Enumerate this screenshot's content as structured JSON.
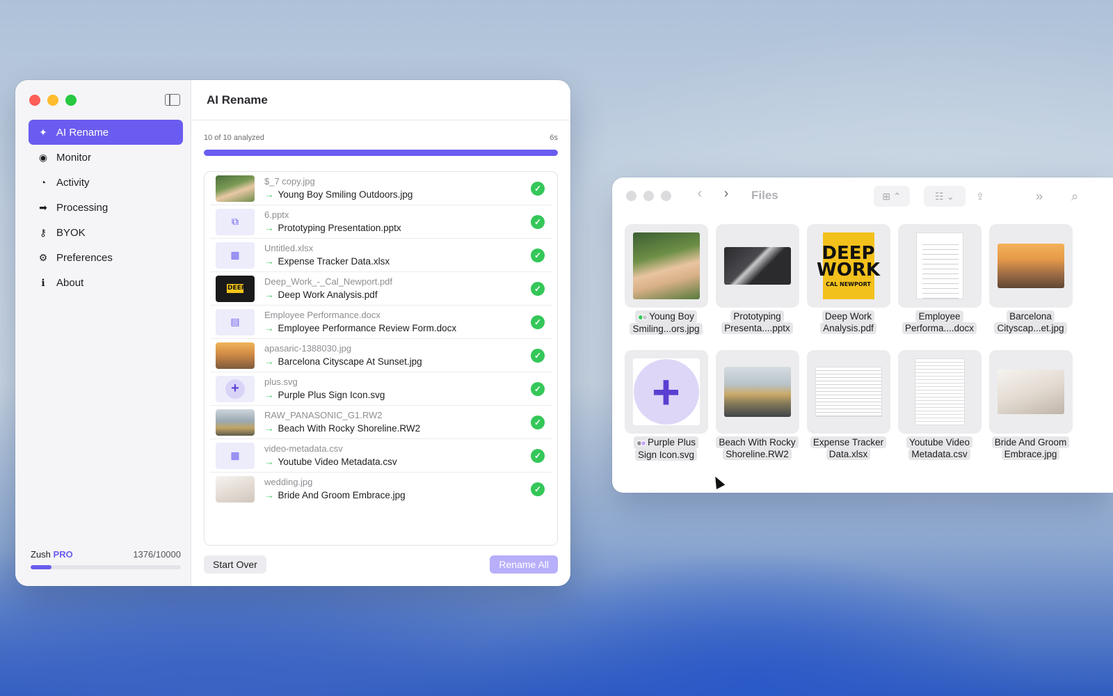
{
  "sidebar": {
    "items": [
      {
        "label": "AI Rename",
        "icon": "ai-rename-icon",
        "glyph": "✦",
        "active": true
      },
      {
        "label": "Monitor",
        "icon": "eye-icon",
        "glyph": "◉",
        "active": false
      },
      {
        "label": "Activity",
        "icon": "clock-icon",
        "glyph": "◔",
        "active": false
      },
      {
        "label": "Processing",
        "icon": "truck-icon",
        "glyph": "➡",
        "active": false
      },
      {
        "label": "BYOK",
        "icon": "key-icon",
        "glyph": "⚷",
        "active": false
      },
      {
        "label": "Preferences",
        "icon": "gear-icon",
        "glyph": "⚙",
        "active": false
      },
      {
        "label": "About",
        "icon": "info-icon",
        "glyph": "ℹ",
        "active": false
      }
    ],
    "plan": {
      "name": "Zush",
      "tier": "PRO",
      "usage_text": "1376/10000",
      "usage_fraction": 0.1376
    }
  },
  "main": {
    "title": "AI Rename",
    "progress": {
      "status": "10 of 10 analyzed",
      "elapsed": "6s",
      "fraction": 1.0
    },
    "files": [
      {
        "old": "$_7 copy.jpg",
        "new": "Young Boy Smiling Outdoors.jpg",
        "thumb": "photo-boy"
      },
      {
        "old": "6.pptx",
        "new": "Prototyping Presentation.pptx",
        "thumb": "generic",
        "glyph": "⧉"
      },
      {
        "old": "Untitled.xlsx",
        "new": "Expense Tracker Data.xlsx",
        "thumb": "generic",
        "glyph": "▦"
      },
      {
        "old": "Deep_Work_-_Cal_Newport.pdf",
        "new": "Deep Work Analysis.pdf",
        "thumb": "book"
      },
      {
        "old": "Employee Performance.docx",
        "new": "Employee Performance Review Form.docx",
        "thumb": "generic",
        "glyph": "▤"
      },
      {
        "old": "apasaric-1388030.jpg",
        "new": "Barcelona Cityscape At Sunset.jpg",
        "thumb": "photo-city"
      },
      {
        "old": "plus.svg",
        "new": "Purple Plus Sign Icon.svg",
        "thumb": "plus"
      },
      {
        "old": "RAW_PANASONIC_G1.RW2",
        "new": "Beach With Rocky Shoreline.RW2",
        "thumb": "photo-beach"
      },
      {
        "old": "video-metadata.csv",
        "new": "Youtube Video Metadata.csv",
        "thumb": "generic",
        "glyph": "▦"
      },
      {
        "old": "wedding.jpg",
        "new": "Bride And Groom Embrace.jpg",
        "thumb": "photo-wedding"
      }
    ],
    "arrow": "→",
    "check": "✓",
    "start_over_label": "Start Over",
    "rename_all_label": "Rename All"
  },
  "finder": {
    "title": "Files",
    "tiles": [
      {
        "line1": "Young Boy",
        "line2": "Smiling...ors.jpg",
        "preview": "prev-boy",
        "tags": [
          "#34c759",
          "#c7c7cc"
        ]
      },
      {
        "line1": "Prototyping",
        "line2": "Presenta....pptx",
        "preview": "prev-pres"
      },
      {
        "line1": "Deep Work",
        "line2": "Analysis.pdf",
        "preview": "prev-book"
      },
      {
        "line1": "Employee",
        "line2": "Performa....docx",
        "preview": "prev-doc"
      },
      {
        "line1": "Barcelona",
        "line2": "Cityscap...et.jpg",
        "preview": "prev-city"
      },
      {
        "line1": "Purple Plus",
        "line2": "Sign Icon.svg",
        "preview": "prev-plus",
        "tags": [
          "#8e8e93",
          "#c9a8f5"
        ]
      },
      {
        "line1": "Beach With Rocky",
        "line2": "Shoreline.RW2",
        "preview": "prev-beach"
      },
      {
        "line1": "Expense Tracker",
        "line2": "Data.xlsx",
        "preview": "prev-sheet"
      },
      {
        "line1": "Youtube Video",
        "line2": "Metadata.csv",
        "preview": "prev-csv"
      },
      {
        "line1": "Bride And Groom",
        "line2": "Embrace.jpg",
        "preview": "prev-wedding"
      }
    ],
    "book_cover": {
      "line1": "DEEP",
      "line2": "WORK",
      "author": "CAL NEWPORT"
    },
    "plus_glyph": "+",
    "icons": {
      "back": "‹",
      "forward": "›",
      "grid": "⊞ ⌃",
      "group": "☷ ⌄",
      "share": "⇪",
      "more": "»",
      "search": "⌕"
    }
  },
  "colors": {
    "accent": "#6a5cf0",
    "success": "#34c759"
  }
}
